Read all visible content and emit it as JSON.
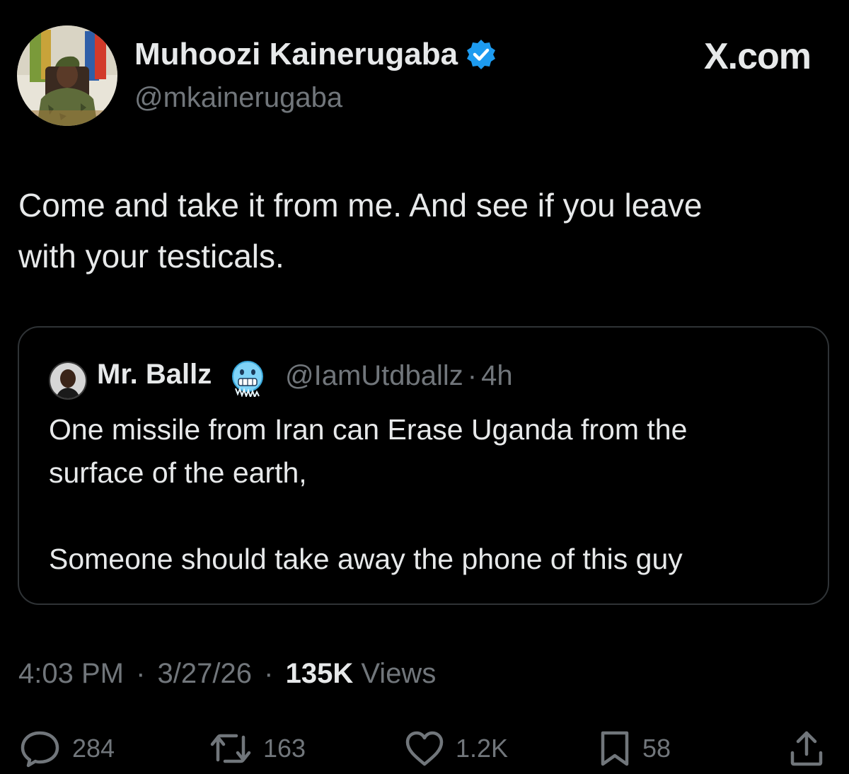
{
  "header": {
    "display_name": "Muhoozi Kainerugaba",
    "handle": "@mkainerugaba",
    "brand": "X.com",
    "verified": true
  },
  "tweet": {
    "line1": "Come and take it from me. And see if you leave",
    "line2": "with your testicals."
  },
  "quote": {
    "display_name": "Mr. Ballz",
    "handle": "@IamUtdballz",
    "separator": "·",
    "age": "4h",
    "line1": "One missile from Iran can Erase Uganda from the",
    "line2": "surface of the earth,",
    "line3": "Someone should take away the phone of this guy",
    "emoji": "cold-face-emoji"
  },
  "meta": {
    "time": "4:03 PM",
    "separator": "·",
    "date": "3/27/26",
    "views_count": "135K",
    "views_label": "Views"
  },
  "actions": {
    "replies": "284",
    "reposts": "163",
    "likes": "1.2K",
    "bookmarks": "58"
  },
  "colors": {
    "background": "#000000",
    "primary_text": "#e7e9ea",
    "secondary_text": "#71767b",
    "border": "#2f3336",
    "verified_badge": "#1d9bf0"
  }
}
